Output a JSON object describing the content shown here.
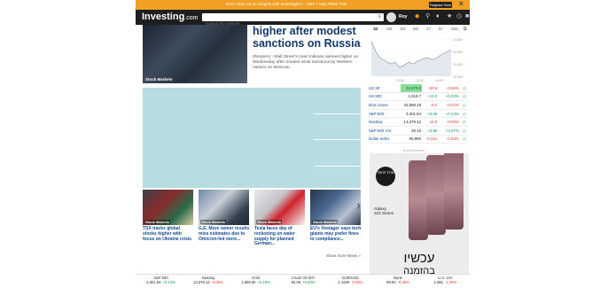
{
  "promo": {
    "text": "Don't miss out on insights with InvestingPro - Start 7 Day FREE Trial",
    "button_label": "Register Now",
    "close_glyph": "✕"
  },
  "nav": {
    "logo_main": "Investing",
    "logo_suffix": ".com",
    "search_placeholder": "Search the website...",
    "user_name": "Roy",
    "icons": [
      "pro-icon",
      "search-icon",
      "bell-icon",
      "star-icon",
      "clock-icon",
      "flag-icon"
    ]
  },
  "hero": {
    "image_tag": "Stock Markets",
    "headline": "higher after modest sanctions on Russia",
    "summary": "(Reuters) - Wall Street's main indexes opened higher on Wednesday after modest initial sanctions by Western nations on Moscow..."
  },
  "cards": [
    {
      "tag": "Stock Markets",
      "title": "TSX tracks global stocks higher with focus on Ukraine crisis"
    },
    {
      "tag": "Stock Markets",
      "title": "G.E. More owner results miss estimates due to Omicron-led store..."
    },
    {
      "tag": "Stock Markets",
      "title": "Tesla faces day of reckoning on water supply for planned German..."
    },
    {
      "tag": "Stock Markets",
      "title": "EU's Vestager says tech giants may prefer fines to compliance..."
    }
  ],
  "show_more": "Show more News »",
  "chart_panel": {
    "timeframes": [
      "1D",
      "1W",
      "1M",
      "6M",
      "1Y",
      "5Y",
      "Max"
    ],
    "expand_icon": "expand-icon",
    "chart_data": {
      "type": "line",
      "series": [
        {
          "values": [
            13900,
            13650,
            13500,
            13450,
            13380,
            13420,
            13300,
            13350,
            13420,
            13380,
            13450,
            13500,
            13520,
            13480,
            13520,
            13600,
            13650,
            13700
          ]
        }
      ],
      "x_ticks": [
        "10:00",
        "12:00",
        "14:00"
      ],
      "y_ticks": [
        "13,800",
        "13,600",
        "13,400",
        "13,200"
      ],
      "ylim": [
        13100,
        13950
      ],
      "grid": true,
      "line_color": "#9aa6b2",
      "fill_color": "#e4e9ef"
    }
  },
  "quotes": {
    "rows": [
      {
        "name": "US 30",
        "last": "33,579.5",
        "chg": "-20.6",
        "pct": "-0.06%",
        "dir": "neg",
        "hl": true
      },
      {
        "name": "US 500",
        "last": "4,319.7",
        "chg": "+14.0",
        "pct": "+0.33%",
        "dir": "pos",
        "hl": false
      },
      {
        "name": "Dow Jones",
        "last": "33,598.18",
        "chg": "-8.0",
        "pct": "-0.02%",
        "dir": "neg",
        "hl": false
      },
      {
        "name": "S&P 500",
        "last": "4,301.94",
        "chg": "+6.05",
        "pct": "+0.14%",
        "dir": "pos",
        "hl": false
      },
      {
        "name": "Nasdaq",
        "last": "13,379.12",
        "chg": "-11.9",
        "pct": "-0.09%",
        "dir": "neg",
        "hl": false
      },
      {
        "name": "S&P 500 VIX",
        "last": "29.16",
        "chg": "+0.95",
        "pct": "+3.37%",
        "dir": "pos",
        "hl": false
      },
      {
        "name": "Dollar Index",
        "last": "95.990",
        "chg": "-0.321",
        "pct": "-0.33%",
        "dir": "neg",
        "hl": false
      }
    ]
  },
  "side_ad": {
    "label": "Advertisement",
    "badge": "מחיר מיוחד",
    "model_line1": "Galaxy",
    "model_line2": "S22 Series",
    "heb_line1": "עכשיו",
    "heb_line2": "בהזמנה"
  },
  "ticker": [
    {
      "name": "S&P 500",
      "value": "4,301.94",
      "chg": "+0.14%",
      "dir": "pos"
    },
    {
      "name": "Nasdaq",
      "value": "13,379.12",
      "chg": "-0.09%",
      "dir": "neg"
    },
    {
      "name": "Gold",
      "value": "1,909.00",
      "chg": "+0.18%",
      "dir": "pos"
    },
    {
      "name": "Crude Oil WTI",
      "value": "92.09",
      "chg": "+0.20%",
      "dir": "pos"
    },
    {
      "name": "EUR/USD",
      "value": "1.1320",
      "chg": "-0.06%",
      "dir": "neg"
    },
    {
      "name": "Bank",
      "value": "99.00",
      "chg": "-0.28%",
      "dir": "neg"
    },
    {
      "name": "U.S. 10Y",
      "value": "1.981",
      "chg": "-1.08%",
      "dir": "neg"
    }
  ]
}
